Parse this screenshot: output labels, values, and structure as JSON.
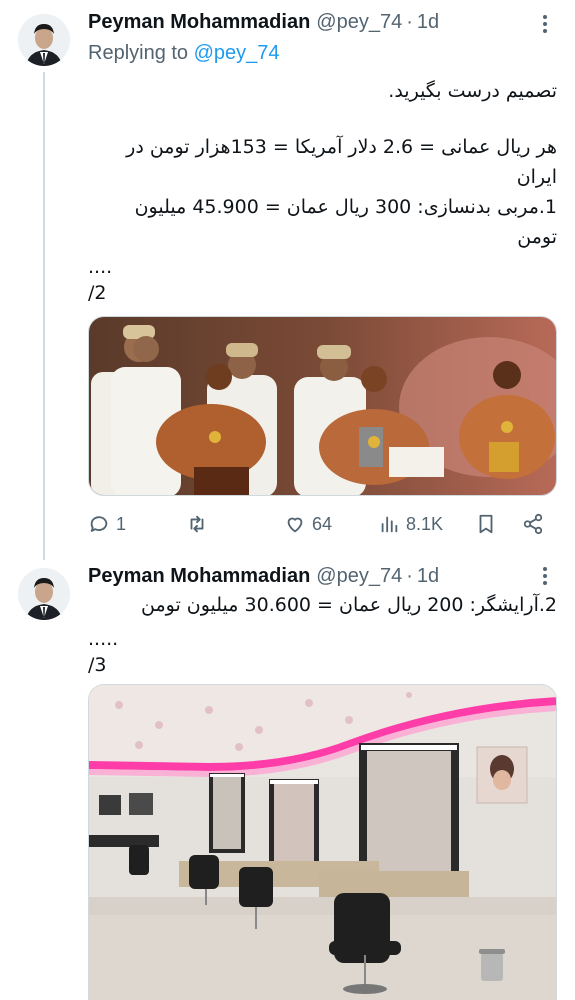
{
  "tweets": [
    {
      "author": "Peyman Mohammadian",
      "handle": "@pey_74",
      "separator": "·",
      "time": "1d",
      "replying_to_label": "Replying to",
      "replying_to_handle": "@pey_74",
      "lines": [
        "تصمیم درست بگیرید.",
        "هر ریال عمانی = 2.6 دلار آمریکا = 153هزار تومن در ایران",
        "1.مربی بدنسازی: 300 ریال عمان = 45.900 میلیون",
        "تومن",
        "....",
        "/2"
      ],
      "image_icon": "bodybuilding-competition-photo",
      "stats": {
        "replies": "1",
        "retweets": "",
        "likes": "64",
        "views": "8.1K"
      }
    },
    {
      "author": "Peyman Mohammadian",
      "handle": "@pey_74",
      "separator": "·",
      "time": "1d",
      "lines": [
        "2.آرایشگر: 200 ریال عمان = 30.600 میلیون تومن",
        ".....",
        "/3"
      ],
      "image_icon": "beauty-salon-interior-photo"
    }
  ],
  "colors": {
    "accent": "#1d9bf0",
    "secondary_text": "#536471",
    "border": "#cfd9de"
  }
}
